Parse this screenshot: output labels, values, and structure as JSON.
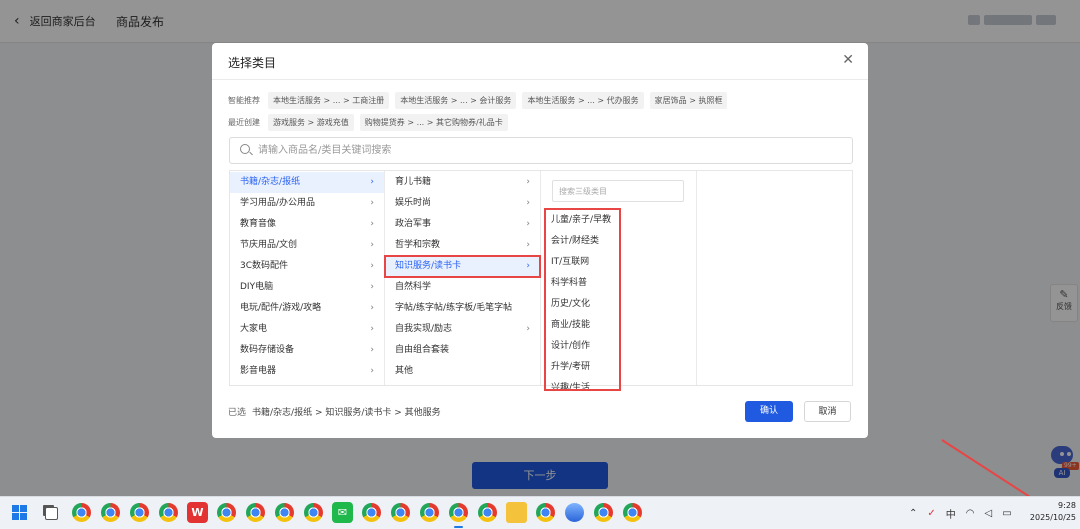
{
  "topbar": {
    "back_label": "返回商家后台",
    "title": "商品发布"
  },
  "page": {
    "next_button": "下一步",
    "feedback_label": "反馈",
    "ai_badge": "99+",
    "ai_label": "AI"
  },
  "modal": {
    "title": "选择类目",
    "recommend_label": "智能推荐",
    "recommend_chips": [
      "本地生活服务 > ... > 工商注册",
      "本地生活服务 > ... > 会计服务",
      "本地生活服务 > ... > 代办服务",
      "家居饰品 > 执照框"
    ],
    "recent_label": "最近创建",
    "recent_chips": [
      "游戏服务 > 游戏充值",
      "购物提货券 > ... > 其它购物券/礼品卡"
    ],
    "search_placeholder": "请输入商品名/类目关键词搜索",
    "level1": [
      "书籍/杂志/报纸",
      "学习用品/办公用品",
      "教育音像",
      "节庆用品/文创",
      "3C数码配件",
      "DIY电脑",
      "电玩/配件/游戏/攻略",
      "大家电",
      "数码存储设备",
      "影音电器"
    ],
    "level2": [
      "育儿书籍",
      "娱乐时尚",
      "政治军事",
      "哲学和宗教",
      "知识服务/读书卡",
      "自然科学",
      "字帖/练字帖/练字板/毛笔字帖",
      "自我实现/励志",
      "自由组合套装",
      "其他"
    ],
    "level3_search_placeholder": "搜索三级类目",
    "level3": [
      "儿童/亲子/早教",
      "会计/财经类",
      "IT/互联网",
      "科学科普",
      "历史/文化",
      "商业/技能",
      "设计/创作",
      "升学/考研",
      "兴趣/生活"
    ],
    "selected_label": "已选",
    "selected_path": "书籍/杂志/报纸 > 知识服务/读书卡 > 其他服务",
    "confirm_button": "确认",
    "cancel_button": "取消"
  },
  "taskbar": {
    "ime": "中",
    "time": "9:28",
    "date": "2025/10/25"
  },
  "colors": {
    "accent": "#1f5ae0",
    "annotation_red": "#e84545",
    "active_item_bg": "#e9f0fe"
  }
}
